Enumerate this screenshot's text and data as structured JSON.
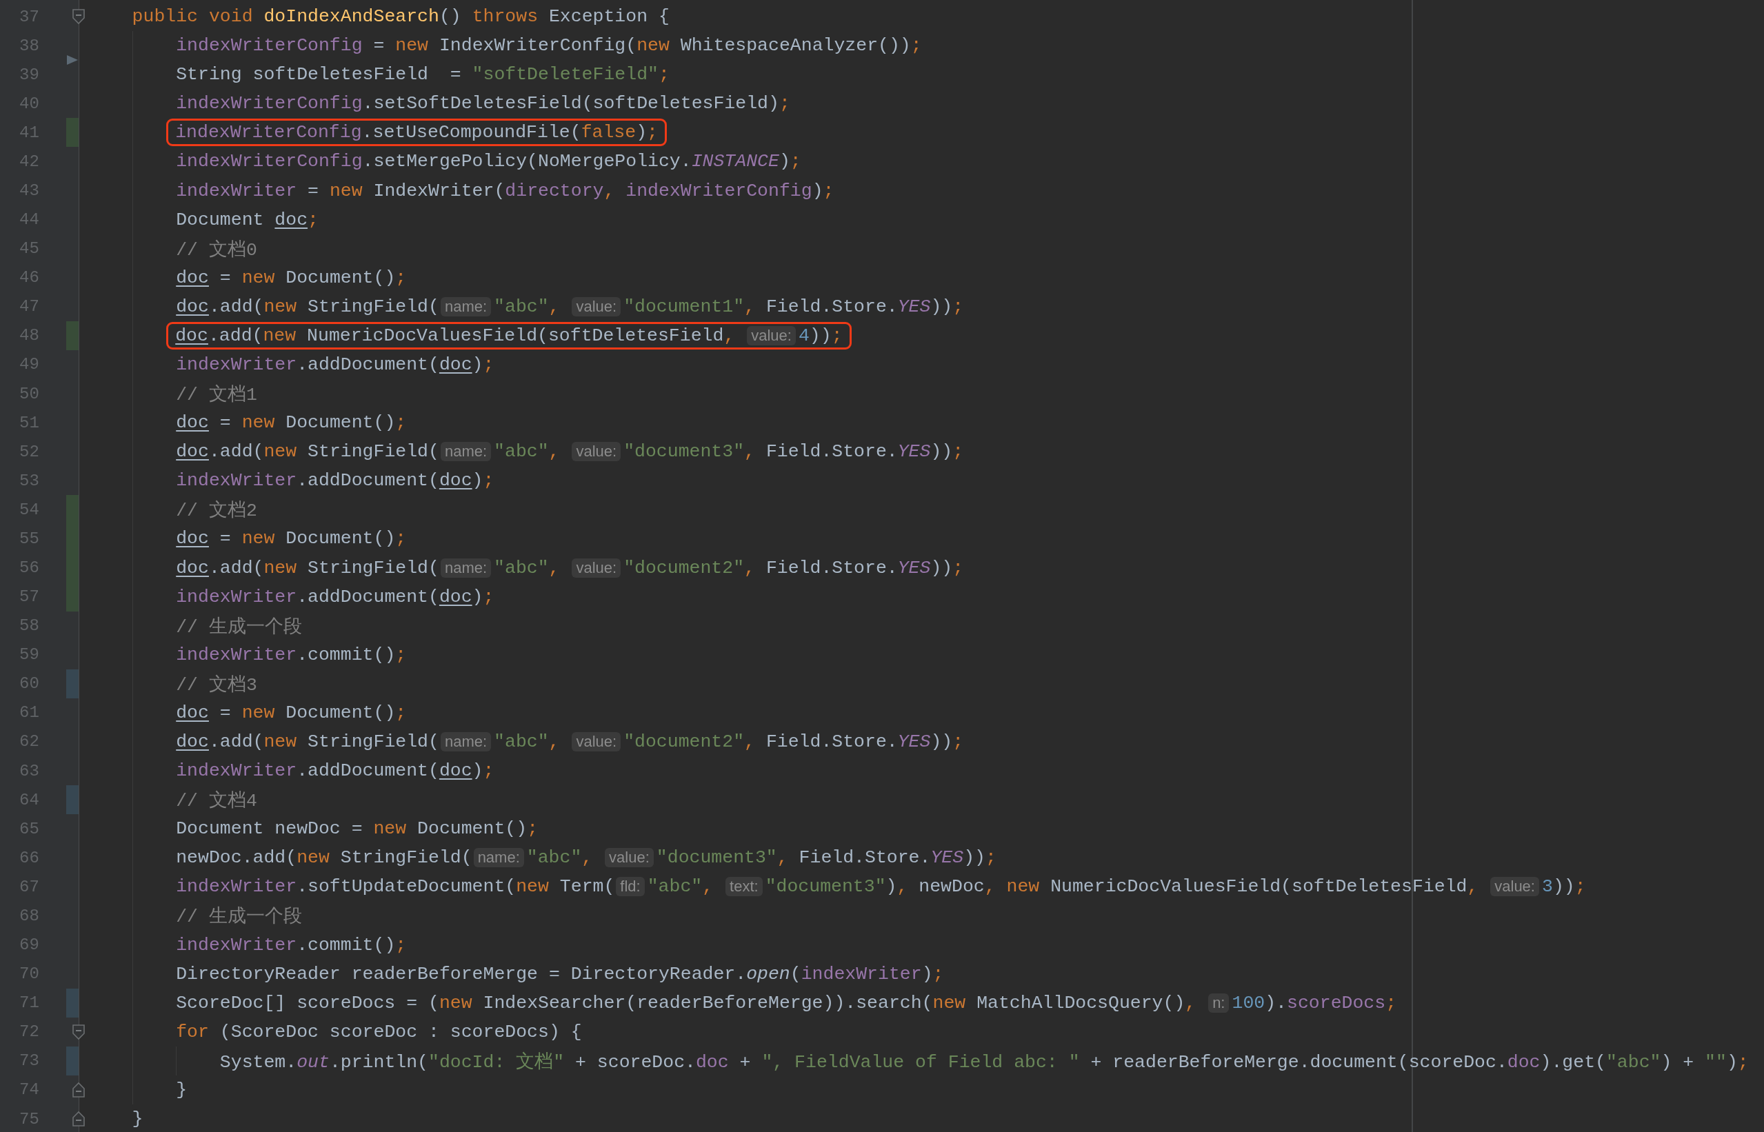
{
  "lines": [
    {
      "n": "37",
      "changed": false,
      "arrow": false,
      "boxed": false,
      "fold_start": true,
      "fold_end": false,
      "tokens": [
        {
          "kind": "keyword",
          "text": "public void "
        },
        {
          "kind": "decl",
          "text": "doIndexAndSearch"
        },
        {
          "kind": "plain",
          "text": "() "
        },
        {
          "kind": "keyword",
          "text": "throws "
        },
        {
          "kind": "plain",
          "text": "Exception {"
        }
      ],
      "children": [
        {
          "n": "38",
          "changed": false,
          "arrow": false,
          "boxed": false,
          "fold_start": false,
          "fold_end": false,
          "tokens": [
            {
              "kind": "field",
              "text": "indexWriterConfig"
            },
            {
              "kind": "plain",
              "text": " = "
            },
            {
              "kind": "keyword",
              "text": "new "
            },
            {
              "kind": "plain",
              "text": "IndexWriterConfig("
            },
            {
              "kind": "keyword",
              "text": "new "
            },
            {
              "kind": "plain",
              "text": "WhitespaceAnalyzer())"
            },
            {
              "kind": "punct",
              "text": ";"
            }
          ]
        },
        {
          "n": "39",
          "changed": false,
          "arrow": true,
          "boxed": false,
          "fold_start": false,
          "fold_end": false,
          "tokens": [
            {
              "kind": "plain",
              "text": "String softDeletesField  = "
            },
            {
              "kind": "string",
              "text": "\"softDeleteField\""
            },
            {
              "kind": "punct",
              "text": ";"
            }
          ]
        },
        {
          "n": "40",
          "changed": false,
          "arrow": false,
          "boxed": false,
          "fold_start": false,
          "fold_end": false,
          "tokens": [
            {
              "kind": "field",
              "text": "indexWriterConfig"
            },
            {
              "kind": "plain",
              "text": ".setSoftDeletesField(softDeletesField)"
            },
            {
              "kind": "punct",
              "text": ";"
            }
          ]
        },
        {
          "n": "41",
          "changed": true,
          "color": "#384c38",
          "arrow": false,
          "boxed": true,
          "fold_start": false,
          "fold_end": false,
          "tokens": [
            {
              "kind": "field",
              "text": "indexWriterConfig"
            },
            {
              "kind": "plain",
              "text": ".setUseCompoundFile("
            },
            {
              "kind": "keyword",
              "text": "false"
            },
            {
              "kind": "plain",
              "text": ")"
            },
            {
              "kind": "punct",
              "text": ";"
            }
          ]
        },
        {
          "n": "42",
          "changed": false,
          "arrow": false,
          "boxed": false,
          "fold_start": false,
          "fold_end": false,
          "tokens": [
            {
              "kind": "field",
              "text": "indexWriterConfig"
            },
            {
              "kind": "plain",
              "text": ".setMergePolicy(NoMergePolicy."
            },
            {
              "kind": "static",
              "text": "INSTANCE"
            },
            {
              "kind": "plain",
              "text": ")"
            },
            {
              "kind": "punct",
              "text": ";"
            }
          ]
        },
        {
          "n": "43",
          "changed": false,
          "arrow": false,
          "boxed": false,
          "fold_start": false,
          "fold_end": false,
          "tokens": [
            {
              "kind": "field",
              "text": "indexWriter"
            },
            {
              "kind": "plain",
              "text": " = "
            },
            {
              "kind": "keyword",
              "text": "new "
            },
            {
              "kind": "plain",
              "text": "IndexWriter("
            },
            {
              "kind": "field",
              "text": "directory"
            },
            {
              "kind": "punct",
              "text": ", "
            },
            {
              "kind": "field",
              "text": "indexWriterConfig"
            },
            {
              "kind": "plain",
              "text": ")"
            },
            {
              "kind": "punct",
              "text": ";"
            }
          ]
        },
        {
          "n": "44",
          "changed": false,
          "arrow": false,
          "boxed": false,
          "fold_start": false,
          "fold_end": false,
          "tokens": [
            {
              "kind": "plain",
              "text": "Document "
            },
            {
              "kind": "local",
              "text": "doc"
            },
            {
              "kind": "punct",
              "text": ";"
            }
          ]
        },
        {
          "n": "45",
          "changed": false,
          "arrow": false,
          "boxed": false,
          "fold_start": false,
          "fold_end": false,
          "tokens": [
            {
              "kind": "comment",
              "text": "// 文档0"
            }
          ]
        },
        {
          "n": "46",
          "changed": false,
          "arrow": false,
          "boxed": false,
          "fold_start": false,
          "fold_end": false,
          "tokens": [
            {
              "kind": "local",
              "text": "doc"
            },
            {
              "kind": "plain",
              "text": " = "
            },
            {
              "kind": "keyword",
              "text": "new "
            },
            {
              "kind": "plain",
              "text": "Document()"
            },
            {
              "kind": "punct",
              "text": ";"
            }
          ]
        },
        {
          "n": "47",
          "changed": false,
          "arrow": false,
          "boxed": false,
          "fold_start": false,
          "fold_end": false,
          "tokens": [
            {
              "kind": "local",
              "text": "doc"
            },
            {
              "kind": "plain",
              "text": ".add("
            },
            {
              "kind": "keyword",
              "text": "new "
            },
            {
              "kind": "plain",
              "text": "StringField("
            },
            {
              "kind": "hint",
              "text": "name:"
            },
            {
              "kind": "string",
              "text": "\"abc\""
            },
            {
              "kind": "punct",
              "text": ", "
            },
            {
              "kind": "hint",
              "text": "value:"
            },
            {
              "kind": "string",
              "text": "\"document1\""
            },
            {
              "kind": "punct",
              "text": ", "
            },
            {
              "kind": "plain",
              "text": "Field.Store."
            },
            {
              "kind": "static",
              "text": "YES"
            },
            {
              "kind": "plain",
              "text": "))"
            },
            {
              "kind": "punct",
              "text": ";"
            }
          ]
        },
        {
          "n": "48",
          "changed": true,
          "color": "#384c38",
          "arrow": false,
          "boxed": true,
          "fold_start": false,
          "fold_end": false,
          "tokens": [
            {
              "kind": "local",
              "text": "doc"
            },
            {
              "kind": "plain",
              "text": ".add("
            },
            {
              "kind": "keyword",
              "text": "new "
            },
            {
              "kind": "plain",
              "text": "NumericDocValuesField(softDeletesField"
            },
            {
              "kind": "punct",
              "text": ", "
            },
            {
              "kind": "hint",
              "text": "value:"
            },
            {
              "kind": "number",
              "text": "4"
            },
            {
              "kind": "plain",
              "text": "))"
            },
            {
              "kind": "punct",
              "text": ";"
            }
          ]
        },
        {
          "n": "49",
          "changed": false,
          "arrow": false,
          "boxed": false,
          "fold_start": false,
          "fold_end": false,
          "tokens": [
            {
              "kind": "field",
              "text": "indexWriter"
            },
            {
              "kind": "plain",
              "text": ".addDocument("
            },
            {
              "kind": "local",
              "text": "doc"
            },
            {
              "kind": "plain",
              "text": ")"
            },
            {
              "kind": "punct",
              "text": ";"
            }
          ]
        },
        {
          "n": "50",
          "changed": false,
          "arrow": false,
          "boxed": false,
          "fold_start": false,
          "fold_end": false,
          "tokens": [
            {
              "kind": "comment",
              "text": "// 文档1"
            }
          ]
        },
        {
          "n": "51",
          "changed": false,
          "arrow": false,
          "boxed": false,
          "fold_start": false,
          "fold_end": false,
          "tokens": [
            {
              "kind": "local",
              "text": "doc"
            },
            {
              "kind": "plain",
              "text": " = "
            },
            {
              "kind": "keyword",
              "text": "new "
            },
            {
              "kind": "plain",
              "text": "Document()"
            },
            {
              "kind": "punct",
              "text": ";"
            }
          ]
        },
        {
          "n": "52",
          "changed": false,
          "arrow": false,
          "boxed": false,
          "fold_start": false,
          "fold_end": false,
          "tokens": [
            {
              "kind": "local",
              "text": "doc"
            },
            {
              "kind": "plain",
              "text": ".add("
            },
            {
              "kind": "keyword",
              "text": "new "
            },
            {
              "kind": "plain",
              "text": "StringField("
            },
            {
              "kind": "hint",
              "text": "name:"
            },
            {
              "kind": "string",
              "text": "\"abc\""
            },
            {
              "kind": "punct",
              "text": ", "
            },
            {
              "kind": "hint",
              "text": "value:"
            },
            {
              "kind": "string",
              "text": "\"document3\""
            },
            {
              "kind": "punct",
              "text": ", "
            },
            {
              "kind": "plain",
              "text": "Field.Store."
            },
            {
              "kind": "static",
              "text": "YES"
            },
            {
              "kind": "plain",
              "text": "))"
            },
            {
              "kind": "punct",
              "text": ";"
            }
          ]
        },
        {
          "n": "53",
          "changed": false,
          "arrow": false,
          "boxed": false,
          "fold_start": false,
          "fold_end": false,
          "tokens": [
            {
              "kind": "field",
              "text": "indexWriter"
            },
            {
              "kind": "plain",
              "text": ".addDocument("
            },
            {
              "kind": "local",
              "text": "doc"
            },
            {
              "kind": "plain",
              "text": ")"
            },
            {
              "kind": "punct",
              "text": ";"
            }
          ]
        },
        {
          "n": "54",
          "changed": true,
          "color": "#384c38",
          "arrow": false,
          "boxed": false,
          "fold_start": false,
          "fold_end": false,
          "tokens": [
            {
              "kind": "comment",
              "text": "// 文档2"
            }
          ]
        },
        {
          "n": "55",
          "changed": true,
          "color": "#384c38",
          "arrow": false,
          "boxed": false,
          "fold_start": false,
          "fold_end": false,
          "tokens": [
            {
              "kind": "local",
              "text": "doc"
            },
            {
              "kind": "plain",
              "text": " = "
            },
            {
              "kind": "keyword",
              "text": "new "
            },
            {
              "kind": "plain",
              "text": "Document()"
            },
            {
              "kind": "punct",
              "text": ";"
            }
          ]
        },
        {
          "n": "56",
          "changed": true,
          "color": "#384c38",
          "arrow": false,
          "boxed": false,
          "fold_start": false,
          "fold_end": false,
          "tokens": [
            {
              "kind": "local",
              "text": "doc"
            },
            {
              "kind": "plain",
              "text": ".add("
            },
            {
              "kind": "keyword",
              "text": "new "
            },
            {
              "kind": "plain",
              "text": "StringField("
            },
            {
              "kind": "hint",
              "text": "name:"
            },
            {
              "kind": "string",
              "text": "\"abc\""
            },
            {
              "kind": "punct",
              "text": ", "
            },
            {
              "kind": "hint",
              "text": "value:"
            },
            {
              "kind": "string",
              "text": "\"document2\""
            },
            {
              "kind": "punct",
              "text": ", "
            },
            {
              "kind": "plain",
              "text": "Field.Store."
            },
            {
              "kind": "static",
              "text": "YES"
            },
            {
              "kind": "plain",
              "text": "))"
            },
            {
              "kind": "punct",
              "text": ";"
            }
          ]
        },
        {
          "n": "57",
          "changed": true,
          "color": "#384c38",
          "arrow": false,
          "boxed": false,
          "fold_start": false,
          "fold_end": false,
          "tokens": [
            {
              "kind": "field",
              "text": "indexWriter"
            },
            {
              "kind": "plain",
              "text": ".addDocument("
            },
            {
              "kind": "local",
              "text": "doc"
            },
            {
              "kind": "plain",
              "text": ")"
            },
            {
              "kind": "punct",
              "text": ";"
            }
          ]
        },
        {
          "n": "58",
          "changed": false,
          "arrow": false,
          "boxed": false,
          "fold_start": false,
          "fold_end": false,
          "tokens": [
            {
              "kind": "comment",
              "text": "// 生成一个段"
            }
          ]
        },
        {
          "n": "59",
          "changed": false,
          "arrow": false,
          "boxed": false,
          "fold_start": false,
          "fold_end": false,
          "tokens": [
            {
              "kind": "field",
              "text": "indexWriter"
            },
            {
              "kind": "plain",
              "text": ".commit()"
            },
            {
              "kind": "punct",
              "text": ";"
            }
          ]
        },
        {
          "n": "60",
          "changed": true,
          "color": "#374752",
          "arrow": false,
          "boxed": false,
          "fold_start": false,
          "fold_end": false,
          "tokens": [
            {
              "kind": "comment",
              "text": "// 文档3"
            }
          ]
        },
        {
          "n": "61",
          "changed": false,
          "arrow": false,
          "boxed": false,
          "fold_start": false,
          "fold_end": false,
          "tokens": [
            {
              "kind": "local",
              "text": "doc"
            },
            {
              "kind": "plain",
              "text": " = "
            },
            {
              "kind": "keyword",
              "text": "new "
            },
            {
              "kind": "plain",
              "text": "Document()"
            },
            {
              "kind": "punct",
              "text": ";"
            }
          ]
        },
        {
          "n": "62",
          "changed": false,
          "arrow": false,
          "boxed": false,
          "fold_start": false,
          "fold_end": false,
          "tokens": [
            {
              "kind": "local",
              "text": "doc"
            },
            {
              "kind": "plain",
              "text": ".add("
            },
            {
              "kind": "keyword",
              "text": "new "
            },
            {
              "kind": "plain",
              "text": "StringField("
            },
            {
              "kind": "hint",
              "text": "name:"
            },
            {
              "kind": "string",
              "text": "\"abc\""
            },
            {
              "kind": "punct",
              "text": ", "
            },
            {
              "kind": "hint",
              "text": "value:"
            },
            {
              "kind": "string",
              "text": "\"document2\""
            },
            {
              "kind": "punct",
              "text": ", "
            },
            {
              "kind": "plain",
              "text": "Field.Store."
            },
            {
              "kind": "static",
              "text": "YES"
            },
            {
              "kind": "plain",
              "text": "))"
            },
            {
              "kind": "punct",
              "text": ";"
            }
          ]
        },
        {
          "n": "63",
          "changed": false,
          "arrow": false,
          "boxed": false,
          "fold_start": false,
          "fold_end": false,
          "tokens": [
            {
              "kind": "field",
              "text": "indexWriter"
            },
            {
              "kind": "plain",
              "text": ".addDocument("
            },
            {
              "kind": "local",
              "text": "doc"
            },
            {
              "kind": "plain",
              "text": ")"
            },
            {
              "kind": "punct",
              "text": ";"
            }
          ]
        },
        {
          "n": "64",
          "changed": true,
          "color": "#374752",
          "arrow": false,
          "boxed": false,
          "fold_start": false,
          "fold_end": false,
          "tokens": [
            {
              "kind": "comment",
              "text": "// 文档4"
            }
          ]
        },
        {
          "n": "65",
          "changed": false,
          "arrow": false,
          "boxed": false,
          "fold_start": false,
          "fold_end": false,
          "tokens": [
            {
              "kind": "plain",
              "text": "Document newDoc = "
            },
            {
              "kind": "keyword",
              "text": "new "
            },
            {
              "kind": "plain",
              "text": "Document()"
            },
            {
              "kind": "punct",
              "text": ";"
            }
          ]
        },
        {
          "n": "66",
          "changed": false,
          "arrow": false,
          "boxed": false,
          "fold_start": false,
          "fold_end": false,
          "tokens": [
            {
              "kind": "plain",
              "text": "newDoc.add("
            },
            {
              "kind": "keyword",
              "text": "new "
            },
            {
              "kind": "plain",
              "text": "StringField("
            },
            {
              "kind": "hint",
              "text": "name:"
            },
            {
              "kind": "string",
              "text": "\"abc\""
            },
            {
              "kind": "punct",
              "text": ", "
            },
            {
              "kind": "hint",
              "text": "value:"
            },
            {
              "kind": "string",
              "text": "\"document3\""
            },
            {
              "kind": "punct",
              "text": ", "
            },
            {
              "kind": "plain",
              "text": "Field.Store."
            },
            {
              "kind": "static",
              "text": "YES"
            },
            {
              "kind": "plain",
              "text": "))"
            },
            {
              "kind": "punct",
              "text": ";"
            }
          ]
        },
        {
          "n": "67",
          "changed": false,
          "arrow": false,
          "boxed": false,
          "fold_start": false,
          "fold_end": false,
          "tokens": [
            {
              "kind": "field",
              "text": "indexWriter"
            },
            {
              "kind": "plain",
              "text": ".softUpdateDocument("
            },
            {
              "kind": "keyword",
              "text": "new "
            },
            {
              "kind": "plain",
              "text": "Term("
            },
            {
              "kind": "hint",
              "text": "fld:"
            },
            {
              "kind": "string",
              "text": "\"abc\""
            },
            {
              "kind": "punct",
              "text": ", "
            },
            {
              "kind": "hint",
              "text": "text:"
            },
            {
              "kind": "string",
              "text": "\"document3\""
            },
            {
              "kind": "plain",
              "text": ")"
            },
            {
              "kind": "punct",
              "text": ", "
            },
            {
              "kind": "plain",
              "text": "newDoc"
            },
            {
              "kind": "punct",
              "text": ", "
            },
            {
              "kind": "keyword",
              "text": "new "
            },
            {
              "kind": "plain",
              "text": "NumericDocValuesField(softDeletesField"
            },
            {
              "kind": "punct",
              "text": ", "
            },
            {
              "kind": "hint",
              "text": "value:"
            },
            {
              "kind": "number",
              "text": "3"
            },
            {
              "kind": "plain",
              "text": "))"
            },
            {
              "kind": "punct",
              "text": ";"
            }
          ]
        },
        {
          "n": "68",
          "changed": false,
          "arrow": false,
          "boxed": false,
          "fold_start": false,
          "fold_end": false,
          "tokens": [
            {
              "kind": "comment",
              "text": "// 生成一个段"
            }
          ]
        },
        {
          "n": "69",
          "changed": false,
          "arrow": false,
          "boxed": false,
          "fold_start": false,
          "fold_end": false,
          "tokens": [
            {
              "kind": "field",
              "text": "indexWriter"
            },
            {
              "kind": "plain",
              "text": ".commit()"
            },
            {
              "kind": "punct",
              "text": ";"
            }
          ]
        },
        {
          "n": "70",
          "changed": false,
          "arrow": false,
          "boxed": false,
          "fold_start": false,
          "fold_end": false,
          "tokens": [
            {
              "kind": "plain",
              "text": "DirectoryReader readerBeforeMerge = DirectoryReader."
            },
            {
              "kind": "smethod",
              "text": "open"
            },
            {
              "kind": "plain",
              "text": "("
            },
            {
              "kind": "field",
              "text": "indexWriter"
            },
            {
              "kind": "plain",
              "text": ")"
            },
            {
              "kind": "punct",
              "text": ";"
            }
          ]
        },
        {
          "n": "71",
          "changed": true,
          "color": "#374752",
          "arrow": false,
          "boxed": false,
          "fold_start": false,
          "fold_end": false,
          "tokens": [
            {
              "kind": "plain",
              "text": "ScoreDoc[] scoreDocs = ("
            },
            {
              "kind": "keyword",
              "text": "new "
            },
            {
              "kind": "plain",
              "text": "IndexSearcher(readerBeforeMerge)).search("
            },
            {
              "kind": "keyword",
              "text": "new "
            },
            {
              "kind": "plain",
              "text": "MatchAllDocsQuery()"
            },
            {
              "kind": "punct",
              "text": ", "
            },
            {
              "kind": "hint",
              "text": "n:"
            },
            {
              "kind": "number",
              "text": "100"
            },
            {
              "kind": "plain",
              "text": ")."
            },
            {
              "kind": "field",
              "text": "scoreDocs"
            },
            {
              "kind": "punct",
              "text": ";"
            }
          ]
        },
        {
          "n": "72",
          "changed": false,
          "arrow": false,
          "boxed": false,
          "fold_start": true,
          "fold_end": false,
          "tokens": [
            {
              "kind": "keyword",
              "text": "for "
            },
            {
              "kind": "plain",
              "text": "(ScoreDoc scoreDoc : scoreDocs) {"
            }
          ],
          "children": [
            {
              "n": "73",
              "changed": true,
              "color": "#374752",
              "arrow": false,
              "boxed": false,
              "fold_start": false,
              "fold_end": false,
              "tokens": [
                {
                  "kind": "plain",
                  "text": "System."
                },
                {
                  "kind": "static",
                  "text": "out"
                },
                {
                  "kind": "plain",
                  "text": ".println("
                },
                {
                  "kind": "string",
                  "text": "\"docId: 文档\""
                },
                {
                  "kind": "plain",
                  "text": " + scoreDoc."
                },
                {
                  "kind": "field",
                  "text": "doc"
                },
                {
                  "kind": "plain",
                  "text": " + "
                },
                {
                  "kind": "string",
                  "text": "\", FieldValue of Field abc: \""
                },
                {
                  "kind": "plain",
                  "text": " + readerBeforeMerge.document(scoreDoc."
                },
                {
                  "kind": "field",
                  "text": "doc"
                },
                {
                  "kind": "plain",
                  "text": ").get("
                },
                {
                  "kind": "string",
                  "text": "\"abc\""
                },
                {
                  "kind": "plain",
                  "text": ") + "
                },
                {
                  "kind": "string",
                  "text": "\"\""
                },
                {
                  "kind": "plain",
                  "text": ")"
                },
                {
                  "kind": "punct",
                  "text": ";"
                }
              ]
            }
          ]
        },
        {
          "n": "74",
          "changed": false,
          "arrow": false,
          "boxed": false,
          "fold_start": false,
          "fold_end": true,
          "tokens": [
            {
              "kind": "plain",
              "text": "}"
            }
          ]
        }
      ]
    },
    {
      "n": "75",
      "changed": false,
      "arrow": false,
      "boxed": false,
      "fold_start": false,
      "fold_end": true,
      "tokens": [
        {
          "kind": "plain",
          "text": "}"
        }
      ]
    }
  ]
}
